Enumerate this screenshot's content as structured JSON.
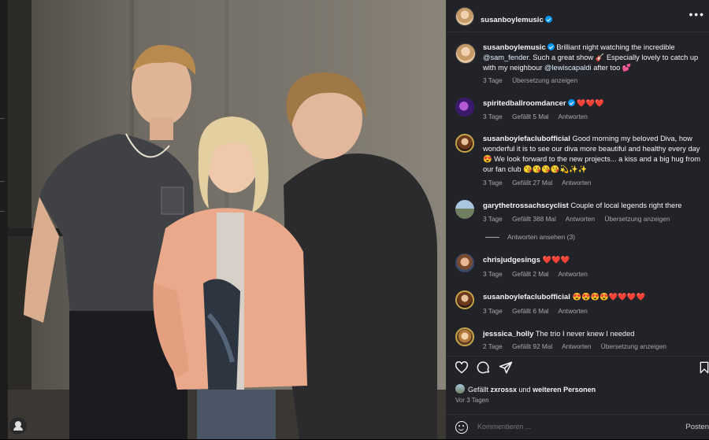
{
  "post": {
    "author": "susanboylemusic",
    "more_icon": "more-horizontal-icon"
  },
  "caption": {
    "username": "susanboylemusic",
    "text_1": " Brilliant night watching the incredible ",
    "mention_1": "@sam_fender",
    "text_2": ". Such a great show 🎸 Especially lovely to catch up with my neighbour ",
    "mention_2": "@lewiscapaldi",
    "text_3": " after too 💕",
    "time": "3 Tage",
    "translate": "Übersetzung anzeigen"
  },
  "comments": [
    {
      "username": "spiritedballroomdancer",
      "verified": true,
      "text": " ❤️❤️❤️",
      "time": "3 Tage",
      "likes": "Gefällt 5 Mal",
      "reply": "Antworten"
    },
    {
      "username": "susanboylefaclubofficial",
      "text": " Good morning my beloved Diva, how wonderful it is to see our diva more beautiful and healthy every day 😍 We look forward to the new projects... a kiss and a big hug from our fan club 😘😘😘😘💫✨✨",
      "time": "3 Tage",
      "likes": "Gefällt 27 Mal",
      "reply": "Antworten"
    },
    {
      "username": "garythetrossachscyclist",
      "text": " Couple of local legends right there",
      "time": "3 Tage",
      "likes": "Gefällt 388 Mal",
      "reply": "Antworten",
      "translate": "Übersetzung anzeigen"
    },
    {
      "username": "chrisjudgesings",
      "text": " ❤️❤️❤️",
      "time": "3 Tage",
      "likes": "Gefällt 2 Mal",
      "reply": "Antworten"
    },
    {
      "username": "susanboylefaclubofficial",
      "text": " 😍😍😍😍❤️❤️❤️❤️",
      "time": "3 Tage",
      "likes": "Gefällt 6 Mal",
      "reply": "Antworten"
    },
    {
      "username": "jesssica_holly",
      "text": " The trio I never knew I needed",
      "time": "2 Tage",
      "likes": "Gefällt 92 Mal",
      "reply": "Antworten",
      "translate": "Übersetzung anzeigen"
    }
  ],
  "view_replies": "Antworten ansehen (3)",
  "likes_line": {
    "prefix": "Gefällt ",
    "user": "zxrossx",
    "middle": " und ",
    "others": "weiteren Personen"
  },
  "post_date": "Vor 3 Tagen",
  "composer": {
    "placeholder": "Kommentieren ...",
    "post_label": "Posten"
  },
  "colors": {
    "panel_bg": "#212328",
    "verified": "#0095f6",
    "secondary_text": "#a8a8a8",
    "heart": "#ed4956"
  }
}
